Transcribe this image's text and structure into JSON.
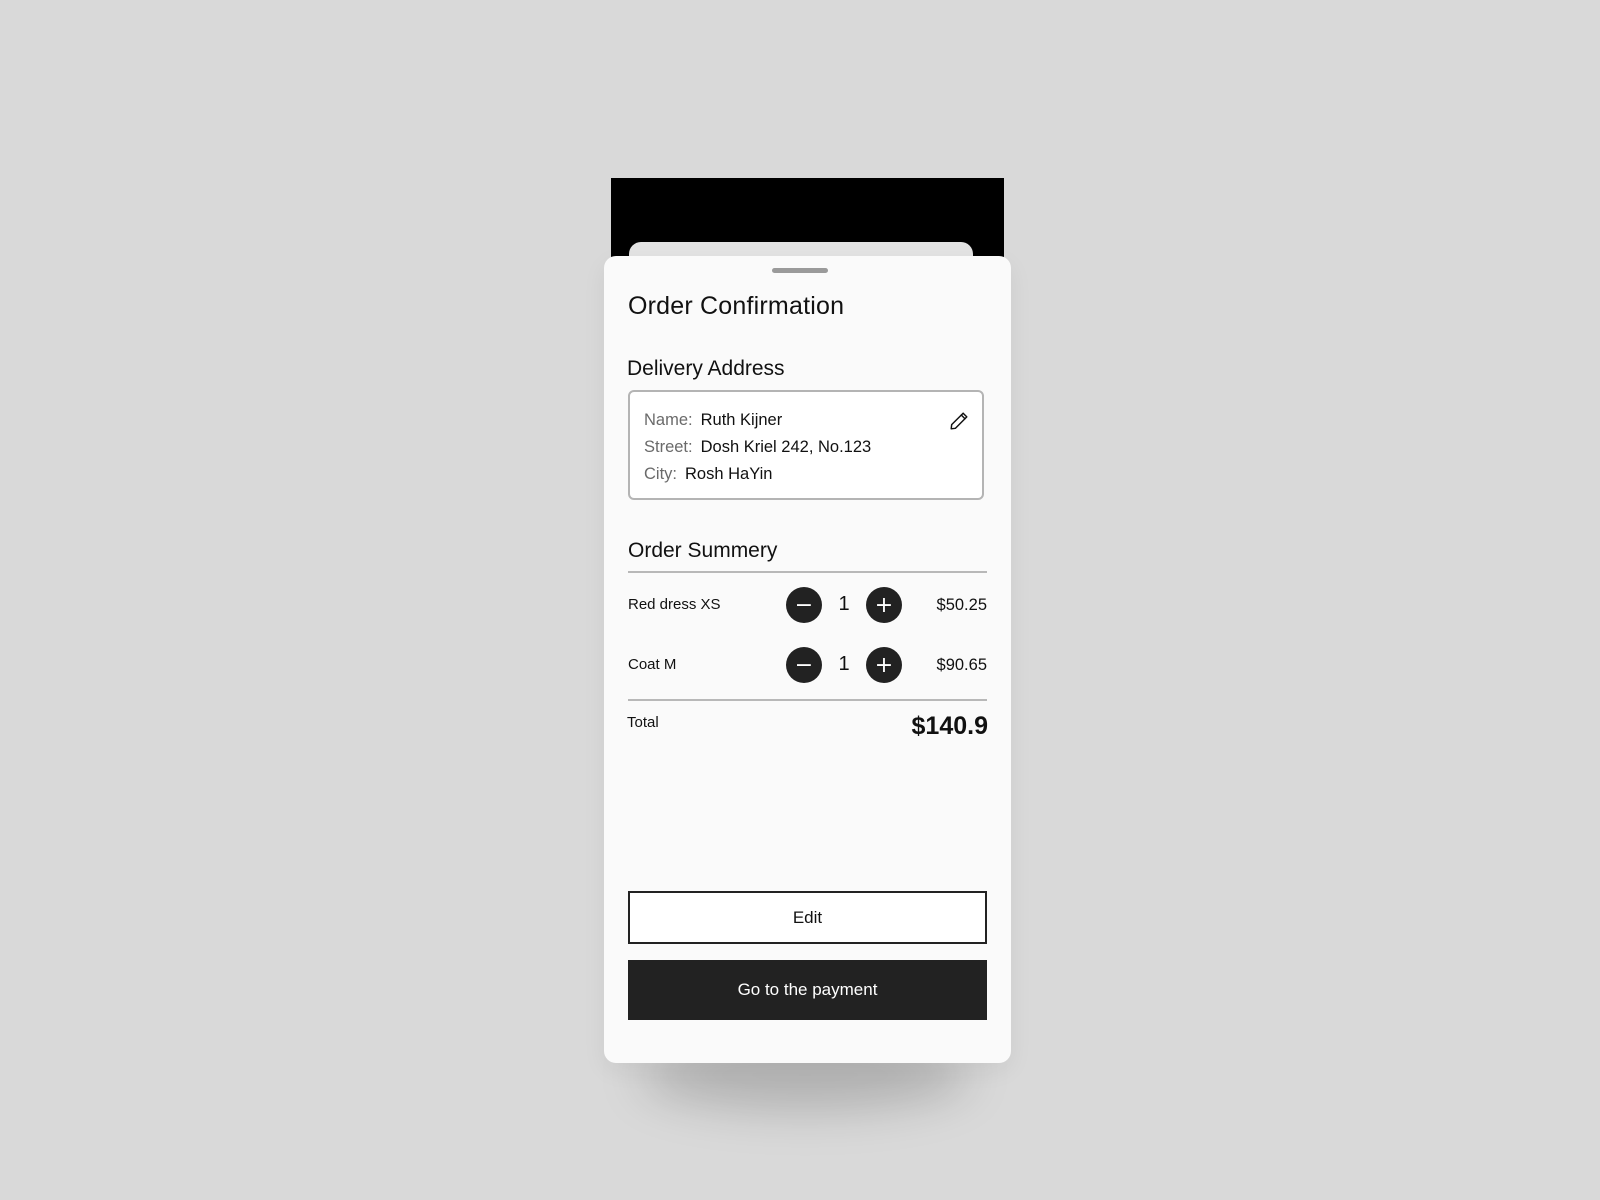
{
  "sheet": {
    "title": "Order Confirmation"
  },
  "delivery": {
    "heading": "Delivery Address",
    "name_label": "Name:",
    "name_value": "Ruth Kijner",
    "street_label": "Street:",
    "street_value": "Dosh Kriel 242, No.123",
    "city_label": "City:",
    "city_value": "Rosh HaYin",
    "edit_icon": "pencil-icon"
  },
  "summary": {
    "heading": "Order Summery",
    "items": [
      {
        "name": "Red dress XS",
        "quantity": "1",
        "price": "$50.25",
        "minus": "−",
        "plus": "+"
      },
      {
        "name": "Coat M",
        "quantity": "1",
        "price": "$90.65",
        "minus": "−",
        "plus": "+"
      }
    ],
    "total_label": "Total",
    "total_value": "$140.9"
  },
  "actions": {
    "edit_label": "Edit",
    "pay_label": "Go to the payment"
  },
  "colors": {
    "background": "#d9d9d9",
    "sheet": "#fafafa",
    "dark": "#222222",
    "border": "#b4b4b4"
  }
}
